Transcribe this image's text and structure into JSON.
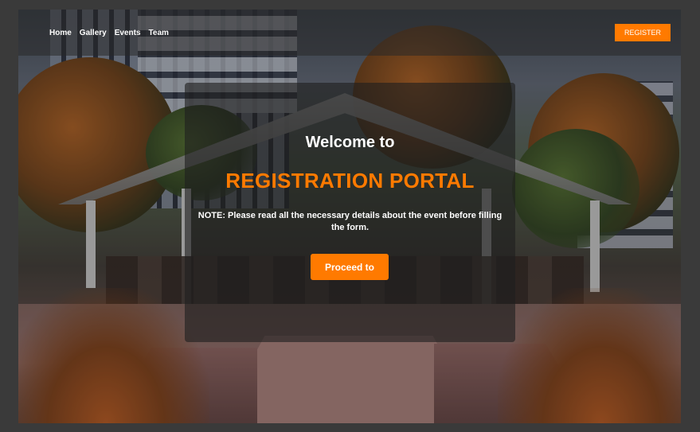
{
  "nav": {
    "links": [
      {
        "label": "Home"
      },
      {
        "label": "Gallery"
      },
      {
        "label": "Events"
      },
      {
        "label": "Team"
      }
    ],
    "register_label": "REGISTER"
  },
  "hero": {
    "welcome": "Welcome to",
    "title": "REGISTRATION PORTAL",
    "note": "NOTE: Please read all the necessary details about the event before filling the form.",
    "proceed_label": "Proceed to"
  },
  "colors": {
    "accent": "#ff7a00",
    "text": "#ffffff",
    "overlay": "rgba(30,30,30,0.62)"
  }
}
